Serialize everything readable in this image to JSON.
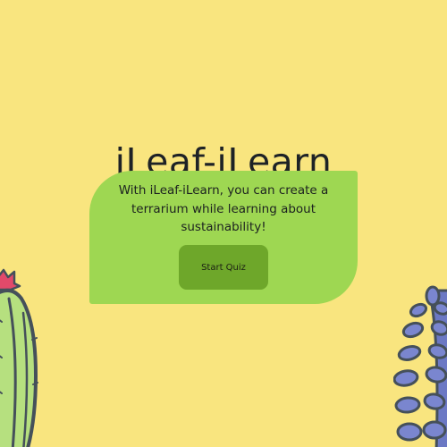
{
  "page": {
    "title": "iLeaf-iLearn"
  },
  "card": {
    "description": "With iLeaf-iLearn, you can create a terrarium while learning about sustainability!",
    "start_button_label": "Start Quiz"
  },
  "decorations": {
    "left_plant_icon": "cactus-icon",
    "right_plant_icon": "succulent-icon"
  },
  "colors": {
    "background": "#f9e57f",
    "card": "#9ed752",
    "button": "#6ea72a",
    "cactus_body": "#b6e07f",
    "cactus_outline": "#45505a",
    "cactus_flower": "#e24a6a",
    "succulent": "#7a86cf"
  }
}
